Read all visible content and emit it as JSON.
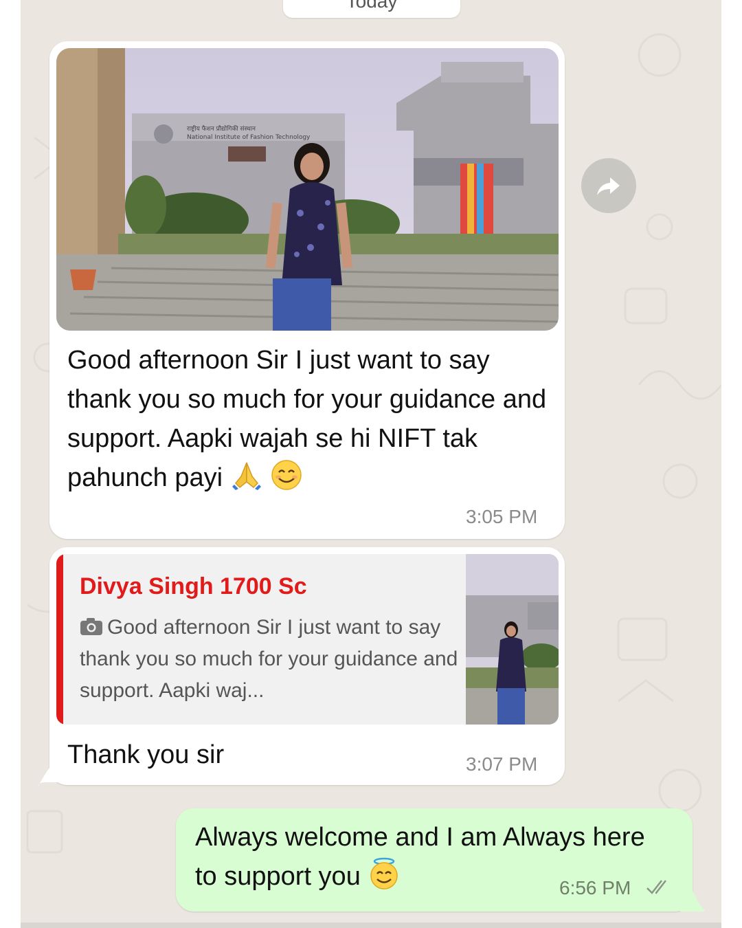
{
  "chat": {
    "date_chip": "Today",
    "messages": [
      {
        "type": "incoming_image",
        "caption_text": "Good afternoon Sir I just want to say thank you so much for your guidance and support. Aapki wajah se hi NIFT tak pahunch payi",
        "caption_emojis": [
          "folded-hands",
          "smiling-face"
        ],
        "photo_sign_line1": "राष्ट्रीय फैशन प्रौद्योगिकी संस्थान",
        "photo_sign_line2": "National Institute of Fashion Technology",
        "time": "3:05 PM"
      },
      {
        "type": "incoming_reply",
        "quote_author": "Divya Singh 1700 Sc",
        "quote_text": "Good afternoon Sir I just want to say thank you so much for your guidance and support. Aapki waj...",
        "text": "Thank you sir",
        "time": "3:07 PM"
      },
      {
        "type": "outgoing",
        "text": "Always welcome and I am Always here to support you",
        "emoji": "smiling-face-with-halo",
        "time": "6:56 PM",
        "status": "delivered"
      }
    ],
    "forward_icon": "forward-arrow-icon"
  },
  "colors": {
    "chat_background": "#ebe7e0",
    "incoming_bubble": "#ffffff",
    "outgoing_bubble": "#d9fdd3",
    "quote_accent": "#e11a1a",
    "timestamp": "#8a8a8a"
  }
}
